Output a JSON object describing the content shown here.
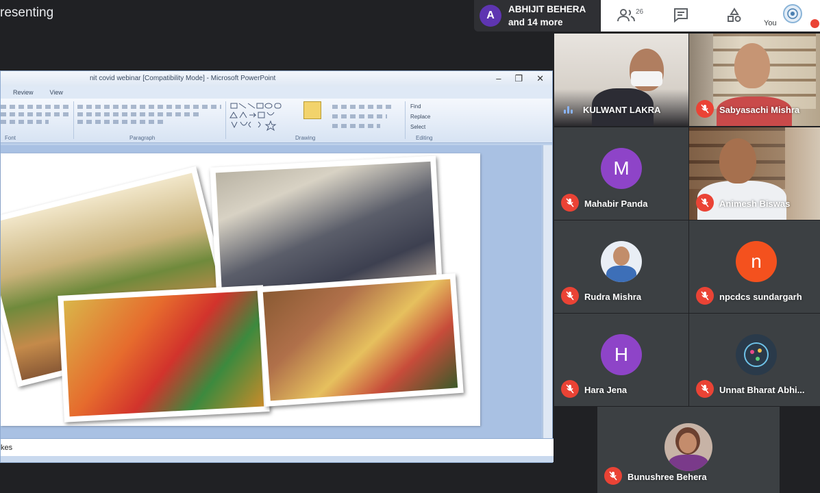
{
  "header": {
    "presenting_text": "resenting"
  },
  "raised_hand": {
    "avatar_letter": "A",
    "name": "ABHIJIT BEHERA",
    "more": "and 14 more"
  },
  "top_panel": {
    "people_count": "26",
    "you_label": "You"
  },
  "ppt": {
    "window_title": "nit covid webinar [Compatibility Mode] - Microsoft PowerPoint",
    "tabs": [
      "Review",
      "View"
    ],
    "groups": [
      "Font",
      "Paragraph",
      "Drawing",
      "Editing"
    ],
    "editing_items": [
      "Find",
      "Replace",
      "Select"
    ],
    "notes_text": "kes"
  },
  "participants": [
    {
      "name": "KULWANT LAKRA",
      "type": "video",
      "muted": false
    },
    {
      "name": "Sabyasachi Mishra",
      "type": "video",
      "muted": true
    },
    {
      "name": "Mahabir Panda",
      "type": "letter",
      "letter": "M",
      "color": "#8e44c8",
      "muted": true
    },
    {
      "name": "Animesh Biswas",
      "type": "video",
      "muted": true
    },
    {
      "name": "Rudra Mishra",
      "type": "photo",
      "muted": true
    },
    {
      "name": "npcdcs sundargarh",
      "type": "letter",
      "letter": "n",
      "color": "#f4511e",
      "muted": true
    },
    {
      "name": "Hara Jena",
      "type": "letter",
      "letter": "H",
      "color": "#8e44c8",
      "muted": true
    },
    {
      "name": "Unnat Bharat Abhi...",
      "type": "logo",
      "muted": true
    },
    {
      "name": "Bunushree Behera",
      "type": "photo",
      "muted": true
    }
  ],
  "colors": {
    "mute_red": "#ea4335",
    "meet_bg": "#202124",
    "tile_bg": "#3c4043"
  }
}
